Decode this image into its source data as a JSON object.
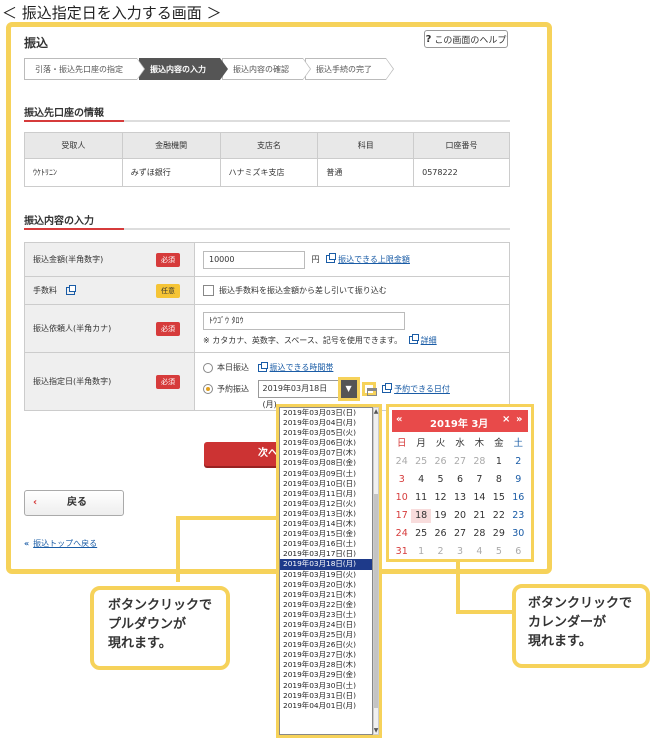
{
  "heading": "＜ 振込指定日を入力する画面 ＞",
  "page": {
    "title": "振込",
    "help_label": "この画面のヘルプ",
    "steps": [
      "引落・振込先口座の指定",
      "振込内容の入力",
      "振込内容の確認",
      "振込手続の完了"
    ],
    "active_step": 1
  },
  "payee": {
    "section_title": "振込先口座の情報",
    "headers": [
      "受取人",
      "金融機関",
      "支店名",
      "科目",
      "口座番号"
    ],
    "row": [
      "ｳｹﾄﾘﾆﾝ",
      "みずほ銀行",
      "ハナミズキ支店",
      "普通",
      "0578222"
    ]
  },
  "form": {
    "section_title": "振込内容の入力",
    "amount_label": "振込金額(半角数字)",
    "amount_value": "10000",
    "amount_unit": "円",
    "amount_link": "振込できる上限金額",
    "fee_label": "手数料",
    "fee_checkbox": "振込手数料を振込金額から差し引いて振り込む",
    "requester_label": "振込依頼人(半角カナ)",
    "requester_value": "ﾄｳｺﾞｳ ﾀﾛｳ",
    "requester_note": "※ カタカナ、英数字、スペース、記号を使用できます。",
    "requester_link": "詳細",
    "date_label": "振込指定日(半角数字)",
    "today_option": "本日振込",
    "today_link": "振込できる時間帯",
    "reserve_option": "予約振込",
    "date_value": "2019年03月18日(月)",
    "date_link": "予約できる日付",
    "required_badge": "必須",
    "optional_badge": "任意"
  },
  "buttons": {
    "next": "次へ",
    "back": "戻る",
    "top_link": "振込トップへ戻る"
  },
  "dropdown": {
    "options": [
      "2019年03月03日(日)",
      "2019年03月04日(月)",
      "2019年03月05日(火)",
      "2019年03月06日(水)",
      "2019年03月07日(木)",
      "2019年03月08日(金)",
      "2019年03月09日(土)",
      "2019年03月10日(日)",
      "2019年03月11日(月)",
      "2019年03月12日(火)",
      "2019年03月13日(水)",
      "2019年03月14日(木)",
      "2019年03月15日(金)",
      "2019年03月16日(土)",
      "2019年03月17日(日)",
      "2019年03月18日(月)",
      "2019年03月19日(火)",
      "2019年03月20日(水)",
      "2019年03月21日(木)",
      "2019年03月22日(金)",
      "2019年03月23日(土)",
      "2019年03月24日(日)",
      "2019年03月25日(月)",
      "2019年03月26日(火)",
      "2019年03月27日(水)",
      "2019年03月28日(木)",
      "2019年03月29日(金)",
      "2019年03月30日(土)",
      "2019年03月31日(日)",
      "2019年04月01日(月)"
    ],
    "selected_index": 15
  },
  "calendar": {
    "title": "2019年 3月",
    "prev": "«",
    "close": "×",
    "next": "»",
    "weekdays": [
      "日",
      "月",
      "火",
      "水",
      "木",
      "金",
      "土"
    ],
    "days": [
      24,
      25,
      26,
      27,
      28,
      1,
      2,
      3,
      4,
      5,
      6,
      7,
      8,
      9,
      10,
      11,
      12,
      13,
      14,
      15,
      16,
      17,
      18,
      19,
      20,
      21,
      22,
      23,
      24,
      25,
      26,
      27,
      28,
      29,
      30,
      31,
      1,
      2,
      3,
      4,
      5,
      6
    ],
    "current_month_start": 5,
    "current_month_end": 35,
    "today_index": 22
  },
  "callouts": {
    "dropdown": [
      "ボタンクリックで",
      "プルダウンが",
      "現れます。"
    ],
    "calendar": [
      "ボタンクリックで",
      "カレンダーが",
      "現れます。"
    ]
  },
  "colors": {
    "accent": "#d63b3b",
    "highlight": "#f6d25a",
    "link": "#1a5ca6"
  }
}
